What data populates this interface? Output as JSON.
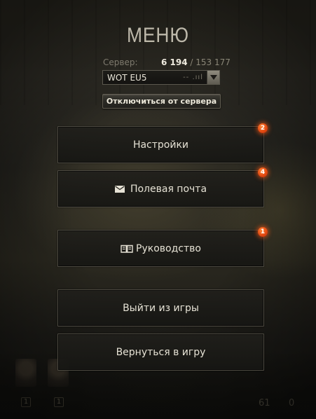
{
  "menu": {
    "title": "МЕНЮ",
    "server_label": "Сервер:",
    "players_online": "6 194",
    "players_separator": " / ",
    "players_total": "153 177",
    "server_selected": "WOT EU5",
    "server_ping": "-- .ııl",
    "disconnect_label": "Отключиться от сервера",
    "buttons": [
      {
        "label": "Настройки",
        "badge": "2",
        "icon": "none"
      },
      {
        "label": "Полевая почта",
        "badge": "4",
        "icon": "envelope-icon"
      },
      {
        "label": "Руководство",
        "badge": "1",
        "icon": "book-icon"
      },
      {
        "label": "Выйти из игры"
      },
      {
        "label": "Вернуться в игру"
      }
    ]
  },
  "background": {
    "slot_left_1": "1",
    "slot_left_2": "1",
    "count_right_1": "61",
    "count_right_2": "0"
  },
  "colors": {
    "badge": "#e24a12",
    "button_border": "#4d4a41",
    "title": "#bdb8aa"
  }
}
